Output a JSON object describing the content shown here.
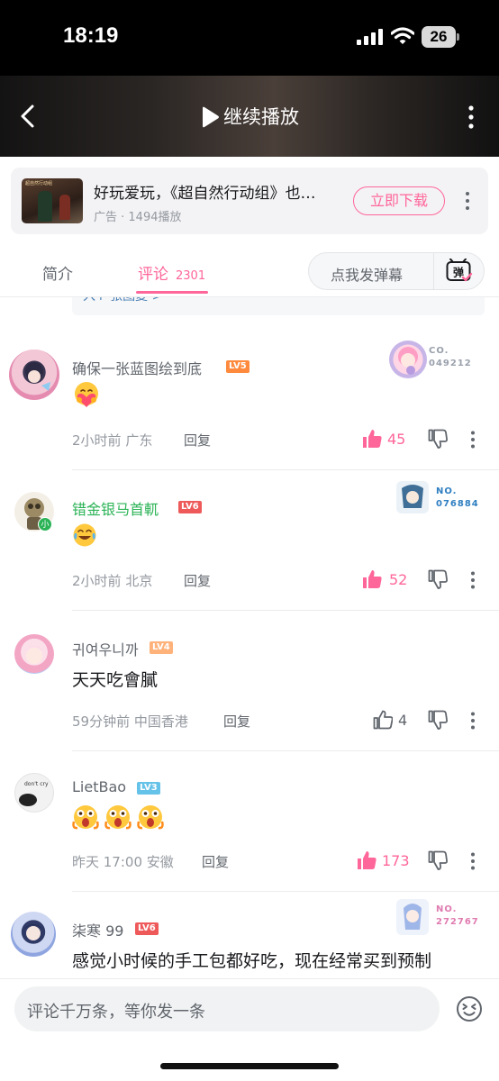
{
  "status_bar": {
    "time": "18:19",
    "battery": "26"
  },
  "video_header": {
    "title": "继续播放"
  },
  "ad": {
    "title": "好玩爱玩，《超自然行动组》也…",
    "meta": "广告 · 1494播放",
    "button": "立即下载",
    "thumb_caption": "超自然行动组"
  },
  "tabs": {
    "intro": "简介",
    "comments": "评论",
    "comments_count": "2301",
    "danmu_placeholder": "点我发弹幕",
    "danmu_icon_label": "弹"
  },
  "prev_fragment": "入↑ 张图复 >",
  "comments": [
    {
      "user": "确保一张蓝图绘到底",
      "level": "LV5",
      "content": "",
      "emoji": [
        "heart-hug-emoji"
      ],
      "time": "2小时前",
      "location": "广东",
      "reply": "回复",
      "likes": "45",
      "liked": true,
      "badge": {
        "line1": "CO.",
        "line2": "049212",
        "color": "#9aa1ac"
      }
    },
    {
      "user": "错金银马首軏",
      "level": "LV6",
      "content": "",
      "emoji": [
        "laugh-cry-emoji"
      ],
      "time": "2小时前",
      "location": "北京",
      "reply": "回复",
      "likes": "52",
      "liked": true,
      "badge": {
        "line1": "NO.",
        "line2": "076884",
        "color": "#2f7fc1"
      },
      "avatar_badge": "小"
    },
    {
      "user": "귀여우니까",
      "level": "LV4",
      "content": "天天吃會膩",
      "emoji": [],
      "time": "59分钟前",
      "location": "中国香港",
      "reply": "回复",
      "likes": "4",
      "liked": false
    },
    {
      "user": "LietBao",
      "level": "LV3",
      "content": "",
      "emoji": [
        "scared-emoji",
        "scared-emoji",
        "scared-emoji"
      ],
      "time": "昨天 17:00",
      "location": "安徽",
      "reply": "回复",
      "likes": "173",
      "liked": true,
      "avatar_text": "don't cry"
    },
    {
      "user": "柒寒 99",
      "level": "LV6",
      "content": "感觉小时候的手工包都好吃，现在经常买到预制",
      "emoji": [],
      "badge": {
        "line1": "NO.",
        "line2": "272767",
        "color": "#e07bb0"
      }
    }
  ],
  "comment_input": {
    "placeholder": "评论千万条，等你发一条"
  },
  "colors": {
    "accent": "#ff6699",
    "lv3": "#65c2e8",
    "lv4": "#ffb27a",
    "lv5": "#ff8a3d",
    "lv6": "#ee5a5a",
    "green_name": "#2bb356"
  }
}
